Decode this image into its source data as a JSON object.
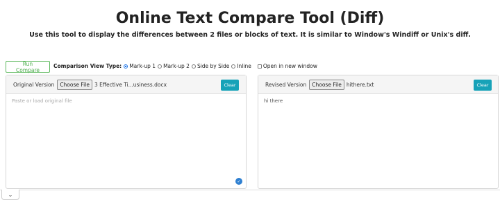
{
  "header": {
    "title": "Online Text Compare Tool (Diff)",
    "subtitle": "Use this tool to display the differences between 2 files or blocks of text. It is similar to Window's Windiff or Unix's diff."
  },
  "toolbar": {
    "run_label": "Run Compare",
    "view_type_label": "Comparison View Type:",
    "options": [
      "Mark-up 1",
      "Mark-up 2",
      "Side by Side",
      "Inline"
    ],
    "selected_option": "Mark-up 1",
    "open_new_window_label": "Open in new window",
    "open_new_window_checked": false
  },
  "original": {
    "label": "Original Version",
    "choose_label": "Choose File",
    "file_name": "3 Effective Ti...usiness.docx",
    "clear_label": "Clear",
    "placeholder": "Paste or load original file",
    "text": ""
  },
  "revised": {
    "label": "Revised Version",
    "choose_label": "Choose File",
    "file_name": "hithere.txt",
    "clear_label": "Clear",
    "text": "hi there"
  },
  "icons": {
    "grammarly": "grammarly-icon",
    "collapse": "chevron-down-icon"
  },
  "colors": {
    "run_border": "#5cb85c",
    "clear_bg": "#17a2b8",
    "radio_checked": "#1a73e8"
  }
}
